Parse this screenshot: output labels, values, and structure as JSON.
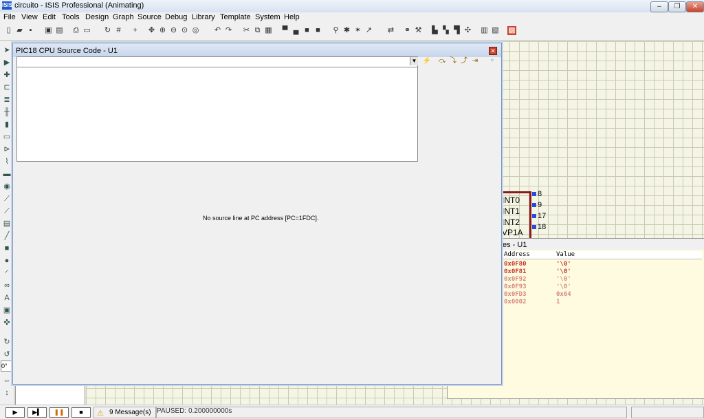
{
  "window": {
    "title": "circuito - ISIS Professional (Animating)",
    "app_icon": "ISIS"
  },
  "menu": [
    "File",
    "View",
    "Edit",
    "Tools",
    "Design",
    "Graph",
    "Source",
    "Debug",
    "Library",
    "Template",
    "System",
    "Help"
  ],
  "source_window": {
    "title": "PIC18 CPU Source Code - U1",
    "message": "No source line at PC address [PC=1FDC]."
  },
  "chip": {
    "pins": [
      {
        "label": "INT0",
        "num": "8"
      },
      {
        "label": "INT1",
        "num": "9"
      },
      {
        "label": "INT2",
        "num": "17"
      },
      {
        "label": "VP1A",
        "num": "18"
      }
    ]
  },
  "watch_window": {
    "title": "es - U1",
    "columns": {
      "address": "Address",
      "value": "Value"
    },
    "rows": [
      {
        "address": "0x0F80",
        "value": "'\\0'"
      },
      {
        "address": "0x0F81",
        "value": "'\\0'"
      },
      {
        "address": "0x0F92",
        "value": "'\\0'"
      },
      {
        "address": "0x0F93",
        "value": "'\\0'"
      },
      {
        "address": "0x0FD3",
        "value": "0x64"
      },
      {
        "address": "0x0002",
        "value": "1"
      }
    ]
  },
  "rotation_value": "0°",
  "status": {
    "messages": "9 Message(s)",
    "sim_state": "PAUSED: 0.200000000s"
  },
  "colors": {
    "accent": "#c8432a",
    "row_text": "#c0392b",
    "grid": "#c9c9b4"
  }
}
